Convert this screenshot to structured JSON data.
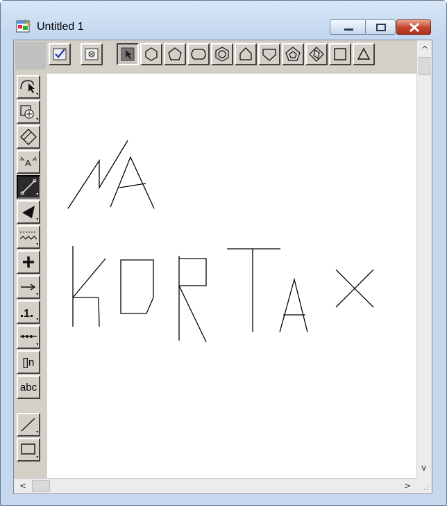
{
  "window": {
    "title": "Untitled 1",
    "icon": "app-drawing-icon",
    "controls": [
      "minimize-icon",
      "maximize-icon",
      "close-icon"
    ],
    "colors": {
      "frame": "#c6d8ee",
      "close": "#c4432b",
      "canvas": "#ffffff",
      "toolbar": "#d4d0c8"
    }
  },
  "shape_toolbar": {
    "tools": [
      {
        "name": "checkmark-tool",
        "icon": "check-icon"
      },
      {
        "name": "camera-tool",
        "icon": "camera-icon"
      },
      {
        "name": "select-tool",
        "icon": "arrow-select-icon",
        "pressed": true
      },
      {
        "name": "hexagon-tool",
        "icon": "hexagon-icon"
      },
      {
        "name": "pentagon-tool",
        "icon": "pentagon-icon"
      },
      {
        "name": "round-hexagon-tool",
        "icon": "rounded-hexagon-icon"
      },
      {
        "name": "nested-hexagon-tool",
        "icon": "nested-hexagon-icon"
      },
      {
        "name": "house-tool",
        "icon": "house-pentagon-icon"
      },
      {
        "name": "shield-tool",
        "icon": "shield-pentagon-icon"
      },
      {
        "name": "nested-pentagon-tool",
        "icon": "nested-pentagon-icon"
      },
      {
        "name": "nested-diamond-tool",
        "icon": "nested-diamond-icon"
      },
      {
        "name": "square-tool",
        "icon": "square-icon"
      },
      {
        "name": "triangle-tool",
        "icon": "triangle-icon"
      }
    ]
  },
  "left_toolbar": {
    "tools": [
      {
        "name": "lasso-select-tool",
        "icon": "lasso-arrow-icon"
      },
      {
        "name": "rotate-tool",
        "icon": "rotate-icon"
      },
      {
        "name": "eraser-tool",
        "icon": "eraser-icon"
      },
      {
        "name": "atom-tool",
        "icon": "atom-icon"
      },
      {
        "name": "bond-tool",
        "icon": "bond-line-icon",
        "active": true
      },
      {
        "name": "wedge-tool",
        "icon": "wedge-icon"
      },
      {
        "name": "chain-tool",
        "icon": "chain-icon"
      },
      {
        "name": "charge-tool",
        "icon": "plus-icon"
      },
      {
        "name": "arrow-tool",
        "icon": "arrow-right-icon"
      },
      {
        "name": "number-tool",
        "icon": "number-icon"
      },
      {
        "name": "dotted-bond-tool",
        "icon": "dotted-line-icon"
      },
      {
        "name": "bracket-tool",
        "icon": "bracket-icon",
        "label": "[]n"
      },
      {
        "name": "text-tool",
        "icon": "text-icon",
        "label": "abc"
      },
      {
        "name": "line-tool",
        "icon": "line-icon"
      },
      {
        "name": "rectangle-tool",
        "icon": "rectangle-icon"
      }
    ]
  },
  "scrollbars": {
    "vertical": {
      "up": "^",
      "down": "v"
    },
    "horizontal": {
      "left": "<",
      "right": ">"
    }
  },
  "canvas": {
    "drawing": "freehand-line-strokes"
  }
}
